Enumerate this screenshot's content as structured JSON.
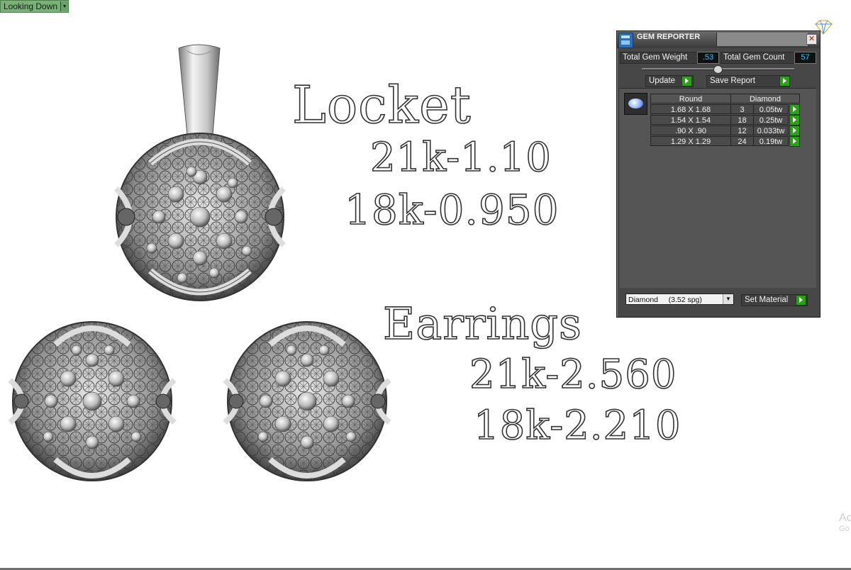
{
  "viewport": {
    "view_label": "Looking Down"
  },
  "annotations": {
    "locket_title": "Locket",
    "locket_21k": "21k-1.10",
    "locket_18k": "18k-0.950",
    "earrings_title": "Earrings",
    "earrings_21k": "21k-2.560",
    "earrings_18k": "18k-2.210"
  },
  "gem_reporter": {
    "title": "GEM REPORTER",
    "total_gem_weight_label": "Total Gem Weight",
    "total_gem_weight_value": ".53",
    "total_gem_count_label": "Total Gem Count",
    "total_gem_count_value": "57",
    "update_button": "Update",
    "save_report_button": "Save Report",
    "table": {
      "col_shape": "Round",
      "col_material": "Diamond",
      "rows": [
        {
          "size": "1.68 X 1.68",
          "count": "3",
          "weight": "0.05tw"
        },
        {
          "size": "1.54 X 1.54",
          "count": "18",
          "weight": "0.25tw"
        },
        {
          "size": ".90 X .90",
          "count": "12",
          "weight": "0.033tw"
        },
        {
          "size": "1.29 X 1.29",
          "count": "24",
          "weight": "0.19tw"
        }
      ]
    },
    "material_select": "Diamond     (3.52 spg)",
    "set_material_button": "Set Material"
  },
  "watermark": {
    "line1": "Ac",
    "line2": "Go"
  },
  "colors": {
    "panel_bg": "#474747",
    "value_text": "#20d0ff",
    "go_button": "#2f9e1e",
    "view_label_bg": "#7bb07b"
  },
  "icons": [
    "dropdown-arrow-icon",
    "gem-reporter-logo-icon",
    "close-icon",
    "gem-thumbnail-icon",
    "play-arrow-icon",
    "diamond-outline-icon"
  ]
}
